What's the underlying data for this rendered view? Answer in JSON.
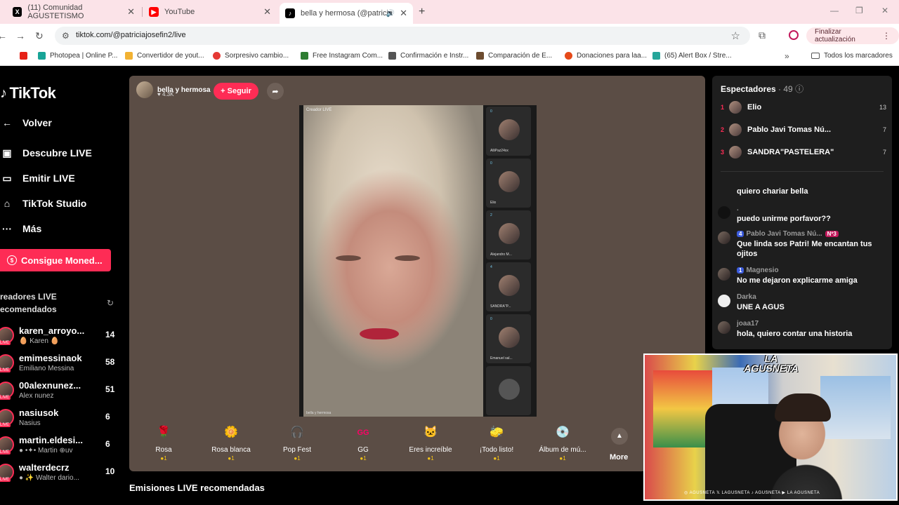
{
  "browser": {
    "tabs": [
      {
        "label": "(11) Comunidad AGUSTETISMO",
        "icon": "x-logo-icon"
      },
      {
        "label": "YouTube",
        "icon": "youtube-icon"
      },
      {
        "label": "bella y hermosa (@patricia",
        "icon": "tiktok-icon"
      }
    ],
    "url": "tiktok.com/@patriciajosefin2/live",
    "update_button": "Finalizar actualización",
    "bookmarks": [
      {
        "label": "",
        "color": "#e62117"
      },
      {
        "label": "Photopea | Online P...",
        "color": "#18a497"
      },
      {
        "label": "Convertidor de yout...",
        "color": "#f2b233"
      },
      {
        "label": "Sorpresivo cambio...",
        "color": "#e53935"
      },
      {
        "label": "Free Instagram Com...",
        "color": "#2e7d32"
      },
      {
        "label": "Confirmación e Instr...",
        "color": "#555555"
      },
      {
        "label": "Comparación de E...",
        "color": "#6d4c2f"
      },
      {
        "label": "Donaciones para laa...",
        "color": "#e64a19"
      },
      {
        "label": "(65) Alert Box / Stre...",
        "color": "#26a69a"
      }
    ],
    "all_bookmarks": "Todos los marcadores"
  },
  "sidebar": {
    "logo": "TikTok",
    "items": [
      {
        "label": "Volver",
        "icon": "arrow-left-icon"
      },
      {
        "label": "Descubre LIVE",
        "icon": "live-tv-icon"
      },
      {
        "label": "Emitir LIVE",
        "icon": "camera-icon"
      },
      {
        "label": "TikTok Studio",
        "icon": "home-icon"
      },
      {
        "label": "Más",
        "icon": "more-icon"
      }
    ],
    "coins_button": "Consigue Moned...",
    "recommended_header": "readores LIVE\necomendados",
    "creators": [
      {
        "name": "karen_arroyo...",
        "sub": "🥚 Karen 🥚",
        "count": "14"
      },
      {
        "name": "emimessinaok",
        "sub": "Emiliano Messina",
        "count": "58"
      },
      {
        "name": "00alexnunez...",
        "sub": "Alex nunez",
        "count": "51"
      },
      {
        "name": "nasiusok",
        "sub": "Nasius",
        "count": "6"
      },
      {
        "name": "martin.eldesi...",
        "sub": "● •✦• Martin ⊕uv",
        "count": "6"
      },
      {
        "name": "walterdecrz",
        "sub": "● ✨ Walter dario...",
        "count": "10"
      }
    ]
  },
  "stream": {
    "host_name": "bella y hermosa",
    "host_likes": "♥ 4.3K",
    "follow_label": "+ Seguir",
    "video_tag": "Creador LIVE",
    "video_footer": "bella y hermosa",
    "guests": [
      {
        "name": "AlliPaz24xx",
        "count": "0"
      },
      {
        "name": "Elio",
        "count": "0"
      },
      {
        "name": "Alejandro M...",
        "count": "2"
      },
      {
        "name": "SANDRA\"P...",
        "count": "4"
      },
      {
        "name": "Emanuel sal...",
        "count": "0"
      },
      {
        "name": "",
        "count": ""
      }
    ],
    "gifts": [
      {
        "label": "Rosa",
        "price": "●1",
        "emoji": "🌹"
      },
      {
        "label": "Rosa blanca",
        "price": "●1",
        "emoji": "🌼"
      },
      {
        "label": "Pop Fest",
        "price": "●1",
        "emoji": "🎧"
      },
      {
        "label": "GG",
        "price": "●1",
        "emoji": "GG"
      },
      {
        "label": "Eres increíble",
        "price": "●1",
        "emoji": "🐱"
      },
      {
        "label": "¡Todo listo!",
        "price": "●1",
        "emoji": "🧽"
      },
      {
        "label": "Álbum de mú...",
        "price": "●1",
        "emoji": "💿"
      }
    ],
    "gifts_more": "More",
    "recommended_streams": "Emisiones LIVE recomendadas"
  },
  "viewers": {
    "title": "Espectadores",
    "count": "· 49",
    "top": [
      {
        "rank": "1",
        "name": "Elio",
        "score": "13"
      },
      {
        "rank": "2",
        "name": "Pablo Javi Tomas Nú...",
        "score": "7"
      },
      {
        "rank": "3",
        "name": "SANDRA\"PASTELERA\"",
        "score": "7"
      }
    ]
  },
  "chat": [
    {
      "user": "",
      "badge": "",
      "badge2": "",
      "text": "quiero chariar bella"
    },
    {
      "user": ".",
      "badge": "",
      "badge2": "",
      "text": "puedo unirme porfavor??"
    },
    {
      "user": "Pablo Javi Tomas Nú...",
      "badge": "4",
      "badge2": "Nº3",
      "text": "Que linda sos Patri! Me encantan tus ojitos"
    },
    {
      "user": "Magnesio",
      "badge": "1",
      "badge2": "",
      "text": "No me dejaron explicarme amiga"
    },
    {
      "user": "Darka",
      "badge": "",
      "badge2": "",
      "text": "UNE A AGUS"
    },
    {
      "user": "joaa17",
      "badge": "",
      "badge2": "",
      "text": "hola, quiero contar una historia"
    }
  ],
  "webcam": {
    "logo": "LA AGUSNETA",
    "socials": "◎ AGUSNETA   𝕏 LAGUSNETA   ♪ AGUSNETA   ▶ LA AGUSNETA"
  }
}
